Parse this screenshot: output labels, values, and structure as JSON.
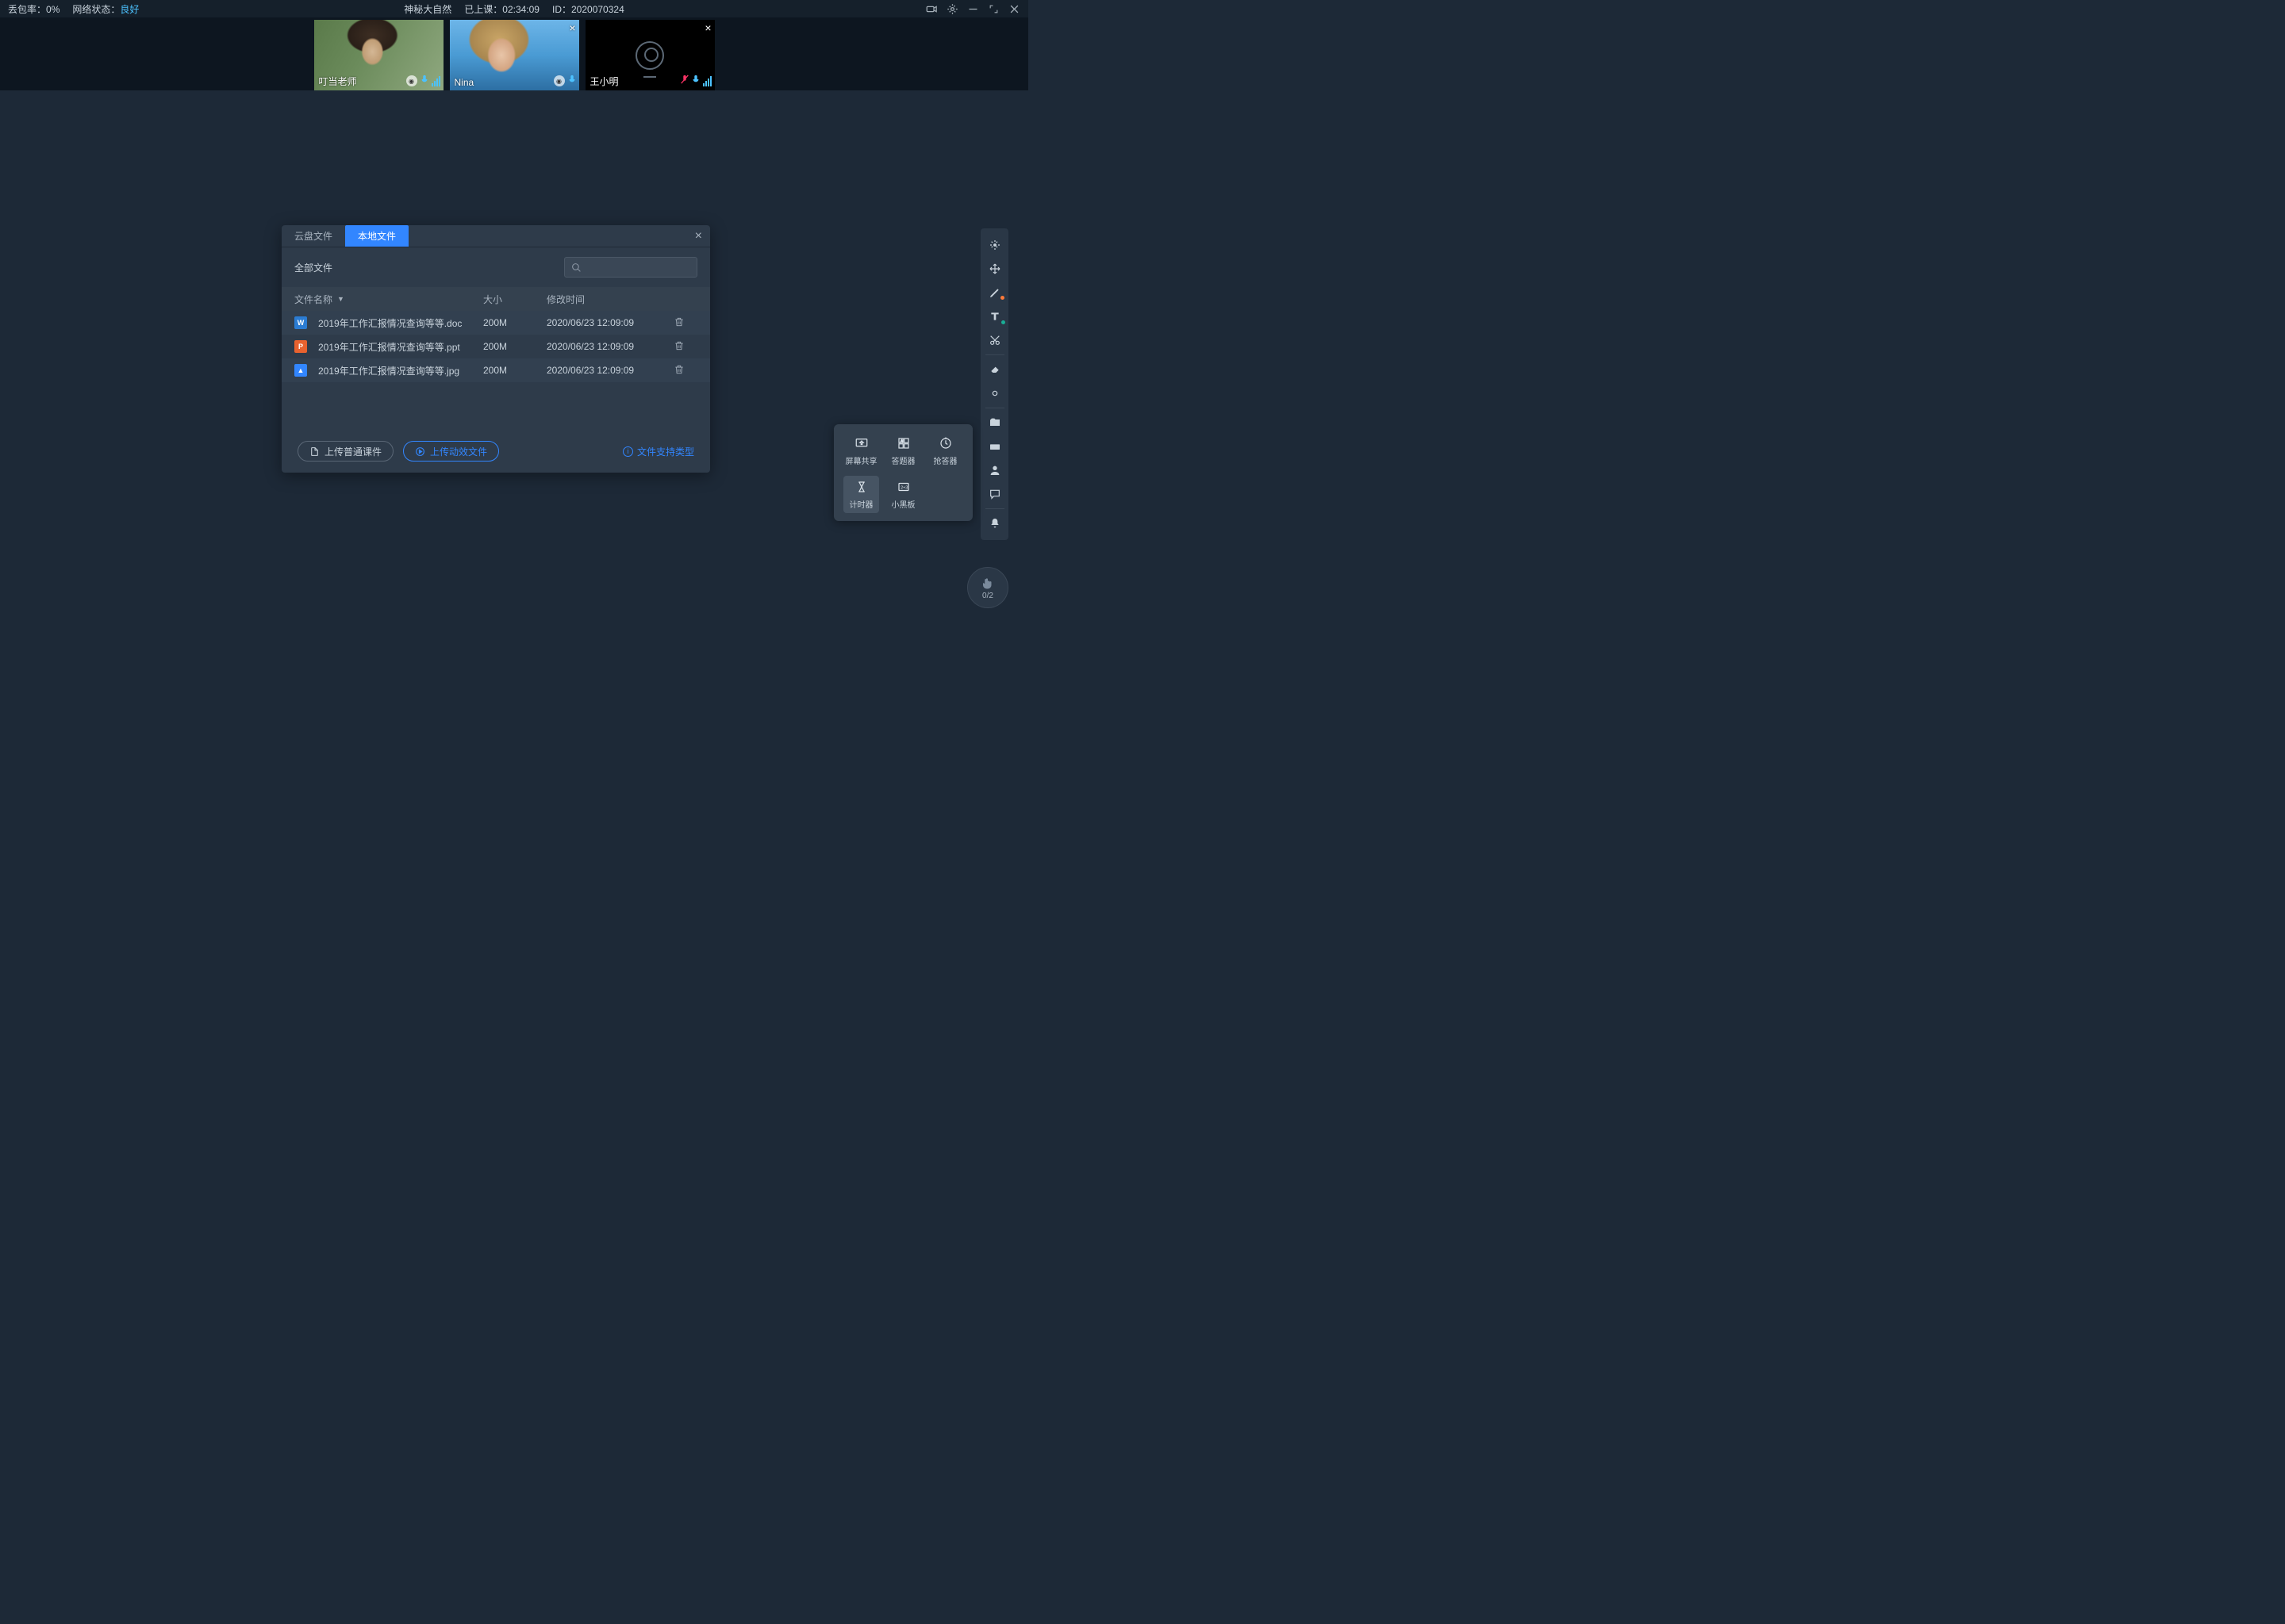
{
  "topbar": {
    "packet_loss_label": "丢包率：",
    "packet_loss_value": "0%",
    "net_status_label": "网络状态：",
    "net_status_value": "良好",
    "title": "神秘大自然",
    "duration_label": "已上课：",
    "duration_value": "02:34:09",
    "id_label": "ID：",
    "id_value": "2020070324"
  },
  "videos": [
    {
      "name": "叮当老师",
      "mic": "on",
      "cam": true,
      "sig": true
    },
    {
      "name": "Nina",
      "mic": "on",
      "cam": true
    },
    {
      "name": "王小明",
      "mic": "on_red",
      "cam": false,
      "sig": true
    }
  ],
  "dialog": {
    "tab_cloud": "云盘文件",
    "tab_local": "本地文件",
    "breadcrumb": "全部文件",
    "col_name": "文件名称",
    "col_size": "大小",
    "col_time": "修改时间",
    "files": [
      {
        "name": "2019年工作汇报情况查询等等.doc",
        "size": "200M",
        "time": "2020/06/23 12:09:09",
        "type": "doc"
      },
      {
        "name": "2019年工作汇报情况查询等等.ppt",
        "size": "200M",
        "time": "2020/06/23 12:09:09",
        "type": "ppt"
      },
      {
        "name": "2019年工作汇报情况查询等等.jpg",
        "size": "200M",
        "time": "2020/06/23 12:09:09",
        "type": "jpg"
      }
    ],
    "btn_upload_normal": "上传普通课件",
    "btn_upload_dynamic": "上传动效文件",
    "help_link": "文件支持类型"
  },
  "tool_popup": {
    "share": "屏幕共享",
    "answer": "答题器",
    "grab": "抢答器",
    "timer": "计时器",
    "board": "小黑板"
  },
  "hand": {
    "count": "0/2"
  }
}
